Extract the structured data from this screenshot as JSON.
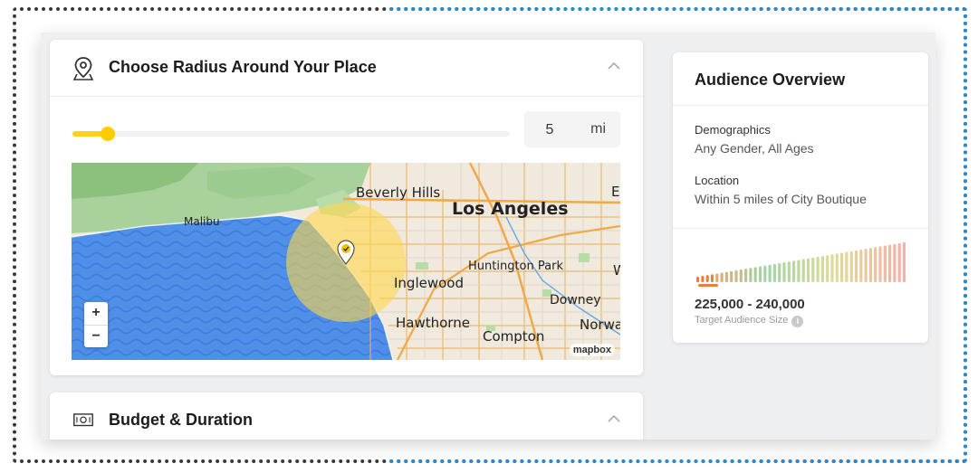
{
  "radius_section": {
    "title": "Choose Radius Around Your Place",
    "radius_value": "5",
    "radius_unit": "mi",
    "slider_fraction": 0.08,
    "slider_color": "#ffd018"
  },
  "map": {
    "labels": {
      "malibu": "Malibu",
      "beverly_hills": "Beverly Hills",
      "los_angeles": "Los Angeles",
      "huntington_park": "Huntington Park",
      "inglewood": "Inglewood",
      "downey": "Downey",
      "hawthorne": "Hawthorne",
      "norwalk": "Norwa",
      "compton": "Compton",
      "east": "E",
      "west": "W"
    },
    "zoom_in": "+",
    "zoom_out": "−",
    "attribution": "mapbox",
    "radius_circle_color": "#ffd74a"
  },
  "budget_section": {
    "title": "Budget & Duration"
  },
  "audience_overview": {
    "title": "Audience Overview",
    "demographics_label": "Demographics",
    "demographics_value": "Any Gender, All Ages",
    "location_label": "Location",
    "location_value": "Within 5 miles of City Boutique",
    "audience_range": "225,000 - 240,000",
    "audience_caption": "Target Audience Size",
    "info_icon": "i",
    "gauge_fraction": 0.04
  },
  "icons": {
    "location": "location-pin-icon",
    "budget": "cash-icon",
    "collapse": "chevron-up-icon",
    "info": "info-icon"
  }
}
